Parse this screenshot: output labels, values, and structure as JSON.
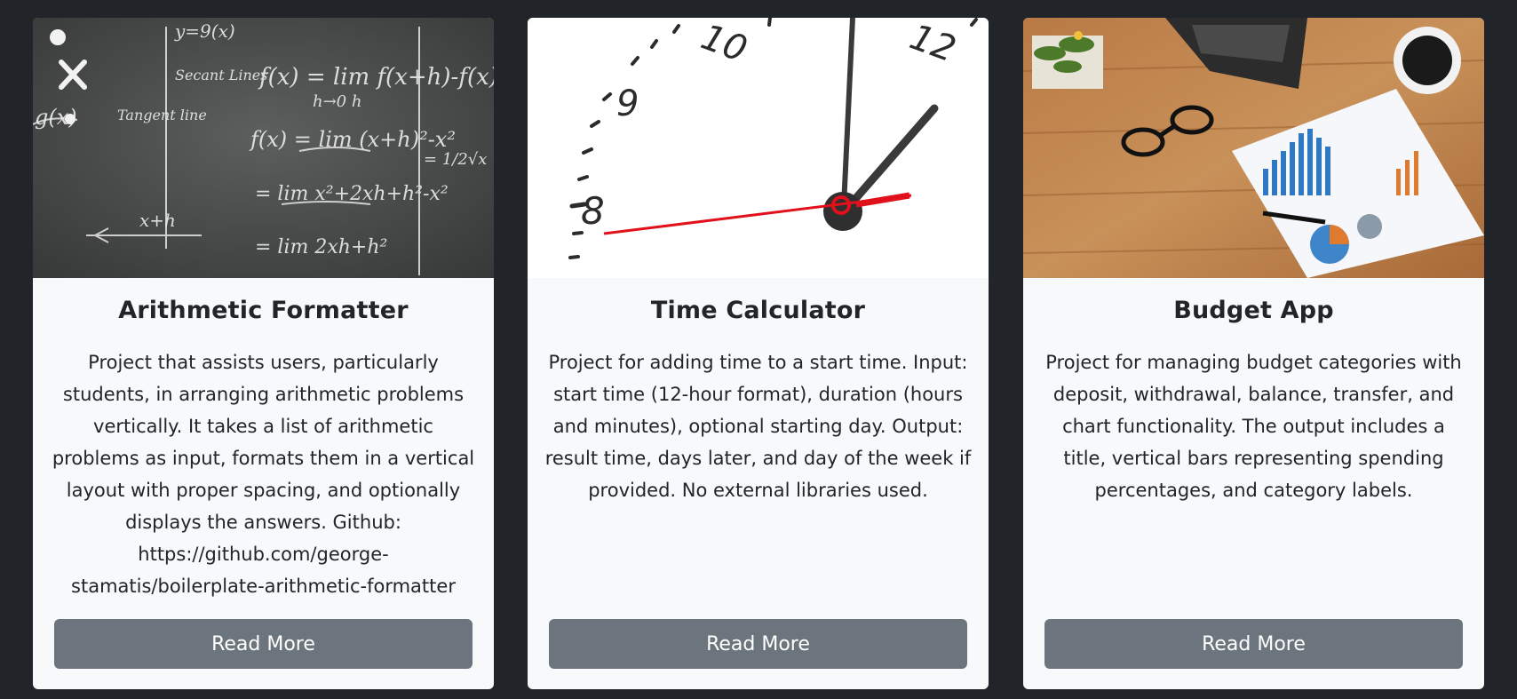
{
  "cards": [
    {
      "title": "Arithmetic Formatter",
      "text": "Project that assists users, particularly students, in arranging arithmetic problems vertically. It takes a list of arithmetic problems as input, formats them in a vertical layout with proper spacing, and optionally displays the answers. Github: https://github.com/george-stamatis/boilerplate-arithmetic-formatter",
      "button": "Read More",
      "image": "chalkboard-formulas-image",
      "board_text": [
        "y=9(x)",
        "f(x) = lim f(x+h)-f(x)",
        "h→0   h",
        "Secant Lines",
        "f(x) = lim (x+h)²-x²",
        "= lim x²+2xh+h²-x²",
        "= lim 2xh+h²",
        "Tangent line",
        "x+h",
        "= 1/2√x",
        "g(x)"
      ]
    },
    {
      "title": "Time Calculator",
      "text": "Project for adding time to a start time. Input: start time (12-hour format), duration (hours and minutes), optional starting day. Output: result time, days later, and day of the week if provided. No external libraries used.",
      "button": "Read More",
      "image": "clock-face-image",
      "clock_numbers": [
        "8",
        "9",
        "10",
        "12"
      ]
    },
    {
      "title": "Budget App",
      "text": "Project for managing budget categories with deposit, withdrawal, balance, transfer, and chart functionality. The output includes a title, vertical bars representing spending percentages, and category labels.",
      "button": "Read More",
      "image": "desk-budget-charts-image"
    }
  ],
  "colors": {
    "page_bg": "#212529",
    "card_bg": "#f8f9fa",
    "button_bg": "#6c757d",
    "text": "#212529",
    "clock_hand_red": "#e0111b"
  }
}
